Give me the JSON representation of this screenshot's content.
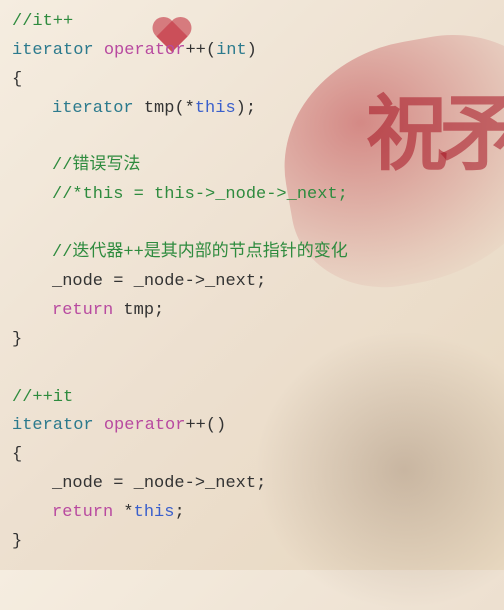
{
  "decoration": {
    "calligraphy": "祝矛"
  },
  "code": {
    "lines": [
      {
        "indent": 0,
        "tokens": [
          {
            "cls": "comment",
            "t": "//it++"
          }
        ]
      },
      {
        "indent": 0,
        "tokens": [
          {
            "cls": "type",
            "t": "iterator"
          },
          {
            "cls": "",
            "t": " "
          },
          {
            "cls": "keyword",
            "t": "operator"
          },
          {
            "cls": "operator",
            "t": "++"
          },
          {
            "cls": "paren",
            "t": "("
          },
          {
            "cls": "type",
            "t": "int"
          },
          {
            "cls": "paren",
            "t": ")"
          }
        ]
      },
      {
        "indent": 0,
        "tokens": [
          {
            "cls": "brace",
            "t": "{"
          }
        ]
      },
      {
        "indent": 1,
        "tokens": [
          {
            "cls": "type",
            "t": "iterator"
          },
          {
            "cls": "",
            "t": " "
          },
          {
            "cls": "ident",
            "t": "tmp"
          },
          {
            "cls": "paren",
            "t": "("
          },
          {
            "cls": "operator",
            "t": "*"
          },
          {
            "cls": "keyword-this",
            "t": "this"
          },
          {
            "cls": "paren",
            "t": ")"
          },
          {
            "cls": "semicolon",
            "t": ";"
          }
        ]
      },
      {
        "indent": 1,
        "tokens": []
      },
      {
        "indent": 1,
        "tokens": [
          {
            "cls": "comment",
            "t": "//错误写法"
          }
        ]
      },
      {
        "indent": 1,
        "tokens": [
          {
            "cls": "comment",
            "t": "//*this = this->_node->_next;"
          }
        ]
      },
      {
        "indent": 1,
        "tokens": []
      },
      {
        "indent": 1,
        "tokens": [
          {
            "cls": "comment",
            "t": "//迭代器++是其内部的节点指针的变化"
          }
        ]
      },
      {
        "indent": 1,
        "tokens": [
          {
            "cls": "ident",
            "t": "_node"
          },
          {
            "cls": "",
            "t": " "
          },
          {
            "cls": "operator",
            "t": "="
          },
          {
            "cls": "",
            "t": " "
          },
          {
            "cls": "ident",
            "t": "_node"
          },
          {
            "cls": "operator",
            "t": "->"
          },
          {
            "cls": "ident",
            "t": "_next"
          },
          {
            "cls": "semicolon",
            "t": ";"
          }
        ]
      },
      {
        "indent": 1,
        "tokens": [
          {
            "cls": "keyword",
            "t": "return"
          },
          {
            "cls": "",
            "t": " "
          },
          {
            "cls": "ident",
            "t": "tmp"
          },
          {
            "cls": "semicolon",
            "t": ";"
          }
        ]
      },
      {
        "indent": 0,
        "tokens": [
          {
            "cls": "brace",
            "t": "}"
          }
        ]
      },
      {
        "indent": 0,
        "tokens": []
      },
      {
        "indent": 0,
        "tokens": [
          {
            "cls": "comment",
            "t": "//++it"
          }
        ]
      },
      {
        "indent": 0,
        "tokens": [
          {
            "cls": "type",
            "t": "iterator"
          },
          {
            "cls": "",
            "t": " "
          },
          {
            "cls": "keyword",
            "t": "operator"
          },
          {
            "cls": "operator",
            "t": "++"
          },
          {
            "cls": "paren",
            "t": "()"
          }
        ]
      },
      {
        "indent": 0,
        "tokens": [
          {
            "cls": "brace",
            "t": "{"
          }
        ]
      },
      {
        "indent": 1,
        "tokens": [
          {
            "cls": "ident",
            "t": "_node"
          },
          {
            "cls": "",
            "t": " "
          },
          {
            "cls": "operator",
            "t": "="
          },
          {
            "cls": "",
            "t": " "
          },
          {
            "cls": "ident",
            "t": "_node"
          },
          {
            "cls": "operator",
            "t": "->"
          },
          {
            "cls": "ident",
            "t": "_next"
          },
          {
            "cls": "semicolon",
            "t": ";"
          }
        ]
      },
      {
        "indent": 1,
        "tokens": [
          {
            "cls": "keyword",
            "t": "return"
          },
          {
            "cls": "",
            "t": " "
          },
          {
            "cls": "operator",
            "t": "*"
          },
          {
            "cls": "keyword-this",
            "t": "this"
          },
          {
            "cls": "semicolon",
            "t": ";"
          }
        ]
      },
      {
        "indent": 0,
        "tokens": [
          {
            "cls": "brace",
            "t": "}"
          }
        ]
      }
    ]
  }
}
